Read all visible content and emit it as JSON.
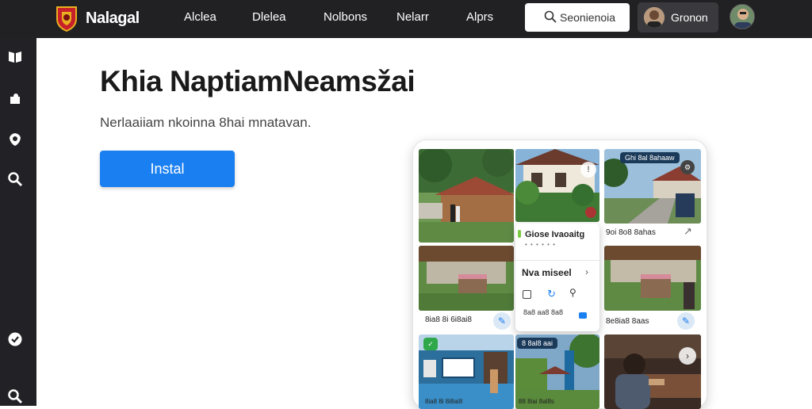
{
  "brand": {
    "name": "Nalagal",
    "logo": "shield-logo"
  },
  "nav": {
    "items": [
      "Alclea",
      "Dlelea",
      "Nolbons",
      "Nelarr",
      "Alprs"
    ]
  },
  "search": {
    "label": "Seonienoia",
    "icon": "search-icon"
  },
  "user": {
    "name": "Gronon"
  },
  "sidebar": {
    "icons": [
      "book-icon",
      "puzzle-icon",
      "shield-icon",
      "search-icon",
      "check-circle-icon",
      "search-icon"
    ]
  },
  "hero": {
    "title": "Khia NaptiamNeamsžai",
    "subtitle": "Nerlaaiiam nkoinna 8hai mnatavan.",
    "install_label": "Instal"
  },
  "gallery": {
    "badge_top_right": "Ghi 8al 8ahaaw",
    "caption_top_right": "9oi 8o8 8ahas",
    "caption_mid_left": "8ia8 8i 6i8ai8",
    "caption_mid_right": "8e8ia8 8aas",
    "caption_bottom_left": "8ia8 8i 8i8ai8",
    "caption_bottom_mid": "88 8iai 8al8s",
    "badge_bottom_mid": "8 8al8 aai"
  },
  "popup": {
    "title": "Giose Ivaoaitg",
    "dots": "• • • • •  •",
    "section": "Nva miseel",
    "footer": "8a8 aa8 8a8"
  },
  "colors": {
    "topbar": "#212124",
    "sidebar": "#222226",
    "accent": "#1a7ff0"
  }
}
